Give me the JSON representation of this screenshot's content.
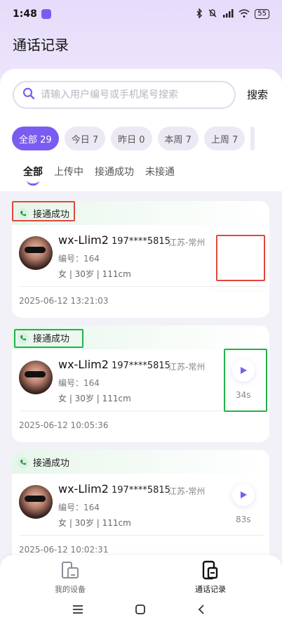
{
  "status_bar": {
    "time": "1:48",
    "battery": "55"
  },
  "page": {
    "title": "通话记录"
  },
  "search": {
    "placeholder": "请输入用户编号或手机尾号搜索",
    "value": "",
    "button_label": "搜索"
  },
  "date_filters": [
    {
      "label": "全部 29",
      "active": true
    },
    {
      "label": "今日 7",
      "active": false
    },
    {
      "label": "昨日 0",
      "active": false
    },
    {
      "label": "本周 7",
      "active": false
    },
    {
      "label": "上周 7",
      "active": false
    }
  ],
  "status_tabs": [
    {
      "label": "全部",
      "active": true
    },
    {
      "label": "上传中",
      "active": false
    },
    {
      "label": "接通成功",
      "active": false
    },
    {
      "label": "未接通",
      "active": false
    }
  ],
  "records": [
    {
      "status": "接通成功",
      "name": "wx-Llim2",
      "phone": "197****5815",
      "region": "江苏-常州",
      "code": "编号：164",
      "meta": "女 | 30岁 | 111cm",
      "timestamp": "2025-06-12 13:21:03",
      "duration": ""
    },
    {
      "status": "接通成功",
      "name": "wx-Llim2",
      "phone": "197****5815",
      "region": "江苏-常州",
      "code": "编号：164",
      "meta": "女 | 30岁 | 111cm",
      "timestamp": "2025-06-12 10:05:36",
      "duration": "34s"
    },
    {
      "status": "接通成功",
      "name": "wx-Llim2",
      "phone": "197****5815",
      "region": "江苏-常州",
      "code": "编号：164",
      "meta": "女 | 30岁 | 111cm",
      "timestamp": "2025-06-12 10:02:31",
      "duration": "83s"
    }
  ],
  "bottom_nav": [
    {
      "label": "我的设备",
      "icon": "device-icon",
      "active": false
    },
    {
      "label": "通话记录",
      "icon": "call-log-icon",
      "active": true
    }
  ],
  "colors": {
    "accent": "#7b5cf0",
    "success_tag_bg": "#e6f6ea",
    "annotation_red": "#e0483d",
    "annotation_green": "#22b24c"
  }
}
